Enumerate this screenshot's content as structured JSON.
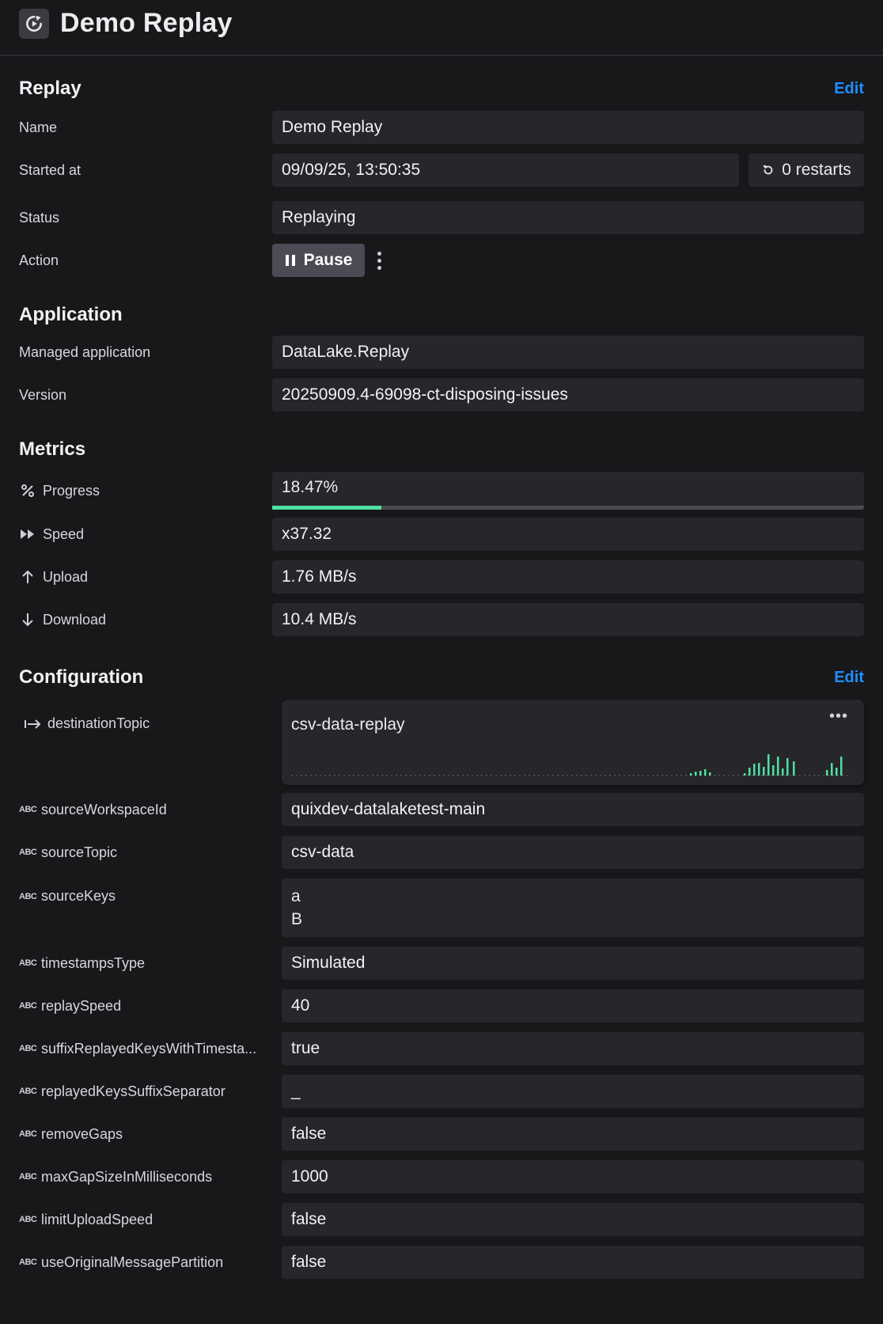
{
  "header": {
    "title": "Demo Replay",
    "icon": "replay-icon"
  },
  "replay": {
    "section_title": "Replay",
    "edit_label": "Edit",
    "name_label": "Name",
    "name_value": "Demo Replay",
    "started_label": "Started at",
    "started_value": "09/09/25, 13:50:35",
    "restarts": "0 restarts",
    "status_label": "Status",
    "status_value": "Replaying",
    "action_label": "Action",
    "pause_label": "Pause"
  },
  "application": {
    "section_title": "Application",
    "managed_label": "Managed application",
    "managed_value": "DataLake.Replay",
    "version_label": "Version",
    "version_value": "20250909.4-69098-ct-disposing-issues"
  },
  "metrics": {
    "section_title": "Metrics",
    "progress_label": "Progress",
    "progress_value": "18.47%",
    "progress_fraction": 0.1847,
    "progress_color": "#4fe0a2",
    "speed_label": "Speed",
    "speed_value": "x37.32",
    "upload_label": "Upload",
    "upload_value": "1.76 MB/s",
    "download_label": "Download",
    "download_value": "10.4 MB/s"
  },
  "configuration": {
    "section_title": "Configuration",
    "edit_label": "Edit",
    "destination_label": "destinationTopic",
    "destination_value": "csv-data-replay",
    "type_badge": "ABC",
    "items": [
      {
        "label": "sourceWorkspaceId",
        "value": "quixdev-datalaketest-main"
      },
      {
        "label": "sourceTopic",
        "value": "csv-data"
      },
      {
        "label": "sourceKeys",
        "value": "a\nB"
      },
      {
        "label": "timestampsType",
        "value": "Simulated"
      },
      {
        "label": "replaySpeed",
        "value": "40"
      },
      {
        "label": "suffixReplayedKeysWithTimesta...",
        "value": "true"
      },
      {
        "label": "replayedKeysSuffixSeparator",
        "value": "_"
      },
      {
        "label": "removeGaps",
        "value": "false"
      },
      {
        "label": "maxGapSizeInMilliseconds",
        "value": "1000"
      },
      {
        "label": "limitUploadSpeed",
        "value": "false"
      },
      {
        "label": "useOriginalMessagePartition",
        "value": "false"
      }
    ]
  },
  "colors": {
    "accent": "#1f8fff",
    "spark": "#4fe0a2",
    "background": "#18181b",
    "field": "#26262b"
  }
}
